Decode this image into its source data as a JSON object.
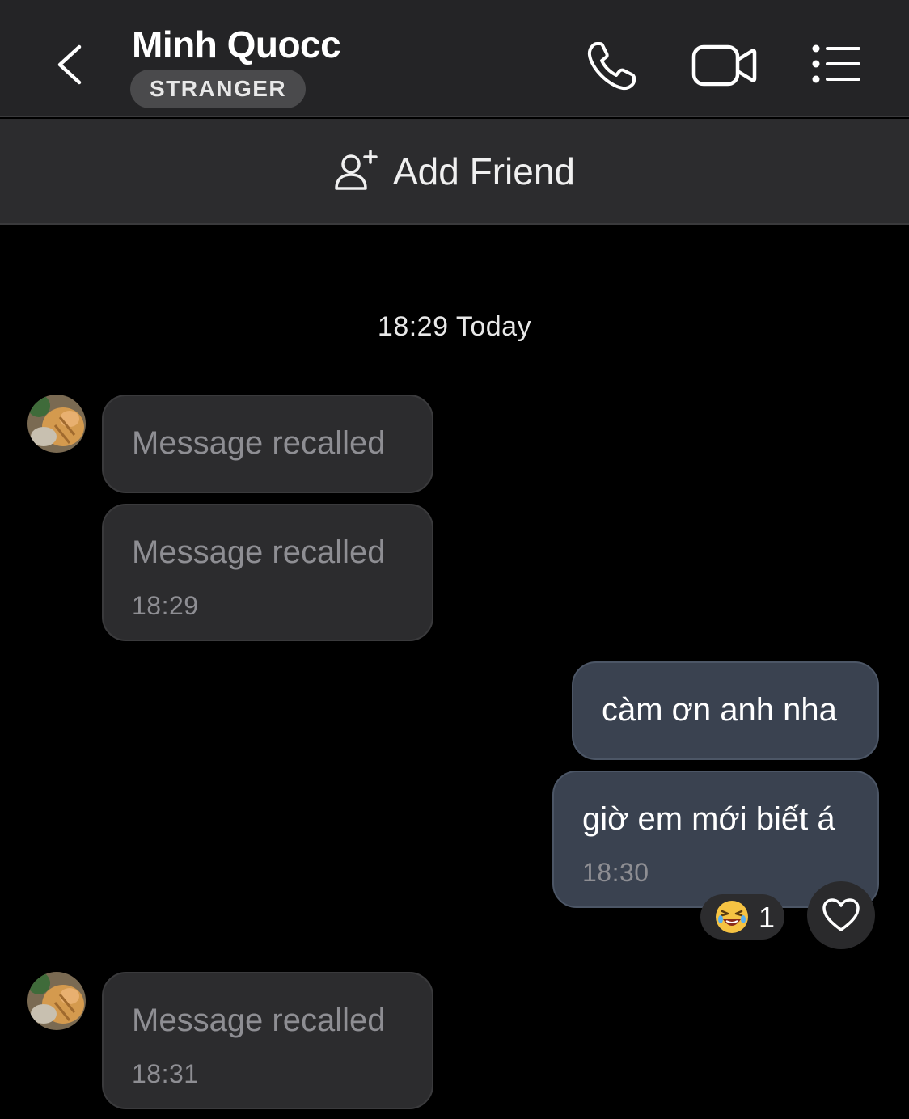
{
  "header": {
    "title": "Minh Quocc",
    "badge": "STRANGER",
    "icons": [
      "back-chevron-icon",
      "phone-icon",
      "video-camera-icon",
      "list-menu-icon"
    ]
  },
  "add_friend": {
    "label": "Add Friend",
    "icon": "add-person-icon"
  },
  "conversation": {
    "date_separator": "18:29 Today",
    "messages": [
      {
        "direction": "incoming",
        "text": "Message recalled",
        "time": ""
      },
      {
        "direction": "incoming",
        "text": "Message recalled",
        "time": "18:29"
      },
      {
        "direction": "outgoing",
        "text": "càm ơn anh nha",
        "time": ""
      },
      {
        "direction": "outgoing",
        "text": "giờ em mới biết á",
        "time": "18:30"
      },
      {
        "direction": "incoming",
        "text": "Message recalled",
        "time": "18:31"
      }
    ],
    "reaction": {
      "emoji": "laughing-emoji",
      "count": "1"
    },
    "react_button": "heart-icon"
  },
  "colors": {
    "header_bg": "#242426",
    "incoming_bubble": "#2c2c2e",
    "outgoing_bubble": "#3a4250",
    "muted_text": "#8e8e93"
  }
}
